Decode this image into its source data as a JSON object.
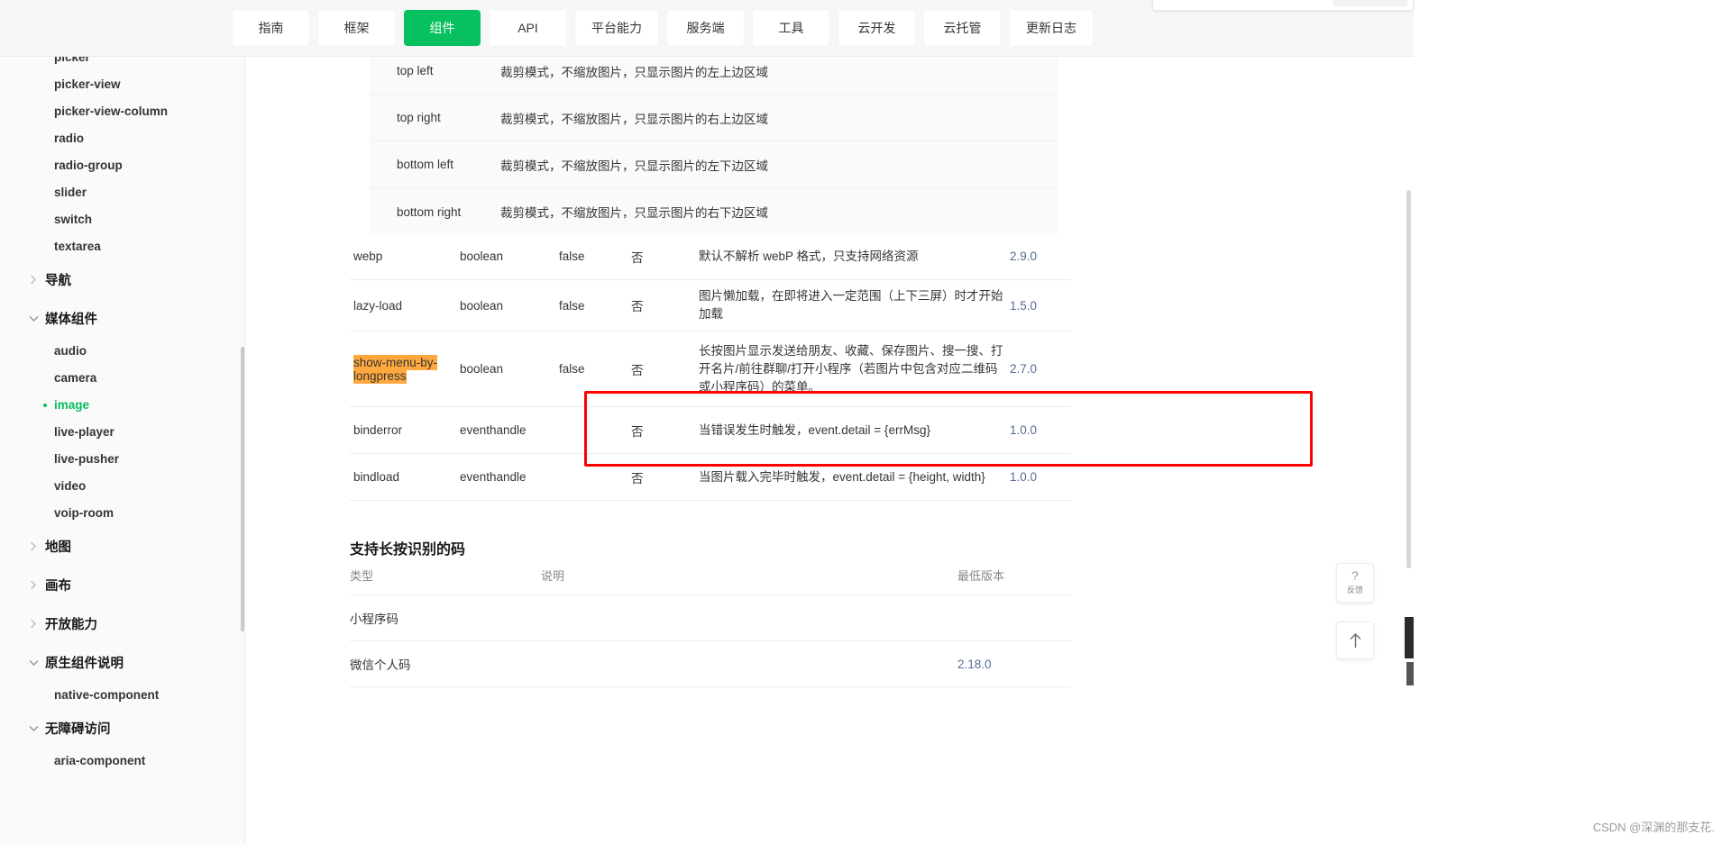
{
  "topbar": {
    "tabs": [
      {
        "label": "指南",
        "active": false
      },
      {
        "label": "框架",
        "active": false
      },
      {
        "label": "组件",
        "active": true
      },
      {
        "label": "API",
        "active": false
      },
      {
        "label": "平台能力",
        "active": false
      },
      {
        "label": "服务端",
        "active": false
      },
      {
        "label": "工具",
        "active": false
      },
      {
        "label": "云开发",
        "active": false
      },
      {
        "label": "云托管",
        "active": false
      },
      {
        "label": "更新日志",
        "active": false
      }
    ]
  },
  "sidebar": {
    "items": [
      {
        "type": "leaf",
        "label": "picker",
        "active": false
      },
      {
        "type": "leaf",
        "label": "picker-view",
        "active": false
      },
      {
        "type": "leaf",
        "label": "picker-view-column",
        "active": false
      },
      {
        "type": "leaf",
        "label": "radio",
        "active": false
      },
      {
        "type": "leaf",
        "label": "radio-group",
        "active": false
      },
      {
        "type": "leaf",
        "label": "slider",
        "active": false
      },
      {
        "type": "leaf",
        "label": "switch",
        "active": false
      },
      {
        "type": "leaf",
        "label": "textarea",
        "active": false
      },
      {
        "type": "group",
        "label": "导航",
        "expanded": false
      },
      {
        "type": "group",
        "label": "媒体组件",
        "expanded": true
      },
      {
        "type": "leaf",
        "label": "audio",
        "active": false
      },
      {
        "type": "leaf",
        "label": "camera",
        "active": false
      },
      {
        "type": "leaf",
        "label": "image",
        "active": true
      },
      {
        "type": "leaf",
        "label": "live-player",
        "active": false
      },
      {
        "type": "leaf",
        "label": "live-pusher",
        "active": false
      },
      {
        "type": "leaf",
        "label": "video",
        "active": false
      },
      {
        "type": "leaf",
        "label": "voip-room",
        "active": false
      },
      {
        "type": "group",
        "label": "地图",
        "expanded": false
      },
      {
        "type": "group",
        "label": "画布",
        "expanded": false
      },
      {
        "type": "group",
        "label": "开放能力",
        "expanded": false
      },
      {
        "type": "group",
        "label": "原生组件说明",
        "expanded": true
      },
      {
        "type": "leaf",
        "label": "native-component",
        "active": false
      },
      {
        "type": "group",
        "label": "无障碍访问",
        "expanded": true
      },
      {
        "type": "leaf",
        "label": "aria-component",
        "active": false
      }
    ]
  },
  "mode_table": {
    "rows": [
      {
        "value": "top left",
        "desc": "裁剪模式，不缩放图片，只显示图片的左上边区域"
      },
      {
        "value": "top right",
        "desc": "裁剪模式，不缩放图片，只显示图片的右上边区域"
      },
      {
        "value": "bottom left",
        "desc": "裁剪模式，不缩放图片，只显示图片的左下边区域"
      },
      {
        "value": "bottom right",
        "desc": "裁剪模式，不缩放图片，只显示图片的右下边区域"
      }
    ]
  },
  "attr_table": {
    "rows": [
      {
        "name": "webp",
        "type": "boolean",
        "default": "false",
        "required": "否",
        "desc": "默认不解析 webP 格式，只支持网络资源",
        "version": "2.9.0",
        "highlighted": false,
        "tall": false
      },
      {
        "name": "lazy-load",
        "type": "boolean",
        "default": "false",
        "required": "否",
        "desc": "图片懒加载，在即将进入一定范围（上下三屏）时才开始加载",
        "version": "1.5.0",
        "highlighted": false,
        "tall": false
      },
      {
        "name": "show-menu-by-longpress",
        "type": "boolean",
        "default": "false",
        "required": "否",
        "desc": "长按图片显示发送给朋友、收藏、保存图片、搜一搜、打开名片/前往群聊/打开小程序（若图片中包含对应二维码或小程序码）的菜单。",
        "version": "2.7.0",
        "highlighted": true,
        "tall": true
      },
      {
        "name": "binderror",
        "type": "eventhandle",
        "default": "",
        "required": "否",
        "desc": "当错误发生时触发，event.detail = {errMsg}",
        "version": "1.0.0",
        "highlighted": false,
        "tall": false
      },
      {
        "name": "bindload",
        "type": "eventhandle",
        "default": "",
        "required": "否",
        "desc": "当图片载入完毕时触发，event.detail = {height, width}",
        "version": "1.0.0",
        "highlighted": false,
        "tall": false
      }
    ]
  },
  "section": {
    "heading": "支持长按识别的码"
  },
  "code_table": {
    "headers": [
      "类型",
      "说明",
      "最低版本"
    ],
    "rows": [
      {
        "type": "小程序码",
        "desc": "",
        "version": ""
      },
      {
        "type": "微信个人码",
        "desc": "",
        "version": "2.18.0"
      }
    ]
  },
  "floating": {
    "feedback_icon": "question-mark-icon",
    "feedback_label": "反馈",
    "back_to_top_icon": "arrow-up-icon"
  },
  "watermark": {
    "text": "CSDN @深渊的那支花."
  },
  "colors": {
    "accent": "#07c160",
    "highlight": "#ffa83e",
    "annotation": "#ff0000",
    "version_link": "#576b95"
  }
}
